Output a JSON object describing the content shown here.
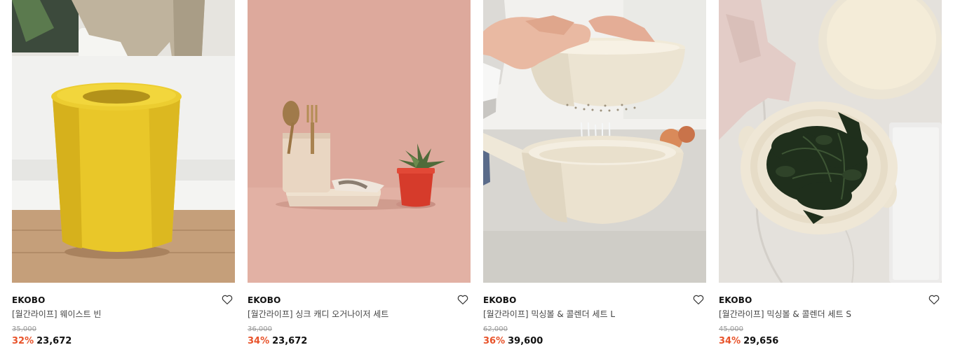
{
  "products": [
    {
      "brand": "EKOBO",
      "name": "[월간라이프] 웨이스트 빈",
      "original_price": "35,000",
      "discount": "32%",
      "price": "23,672",
      "image": "yellow-waste-bin-photo"
    },
    {
      "brand": "EKOBO",
      "name": "[월간라이프] 싱크 캐디 오거나이저 세트",
      "original_price": "36,000",
      "discount": "34%",
      "price": "23,672",
      "image": "sink-caddy-organizer-photo"
    },
    {
      "brand": "EKOBO",
      "name": "[월간라이프] 믹싱볼 & 콜렌더 세트 L",
      "original_price": "62,000",
      "discount": "36%",
      "price": "39,600",
      "image": "mixing-bowl-colander-photo"
    },
    {
      "brand": "EKOBO",
      "name": "[월간라이프] 믹싱볼 & 콜렌더 세트 S",
      "original_price": "45,000",
      "discount": "34%",
      "price": "29,656",
      "image": "colander-with-kale-photo"
    }
  ],
  "colors": {
    "discount": "#e8532a",
    "original_price": "#9a9a9a",
    "brand": "#111111"
  },
  "icons": {
    "wishlist": "heart-outline-icon"
  }
}
